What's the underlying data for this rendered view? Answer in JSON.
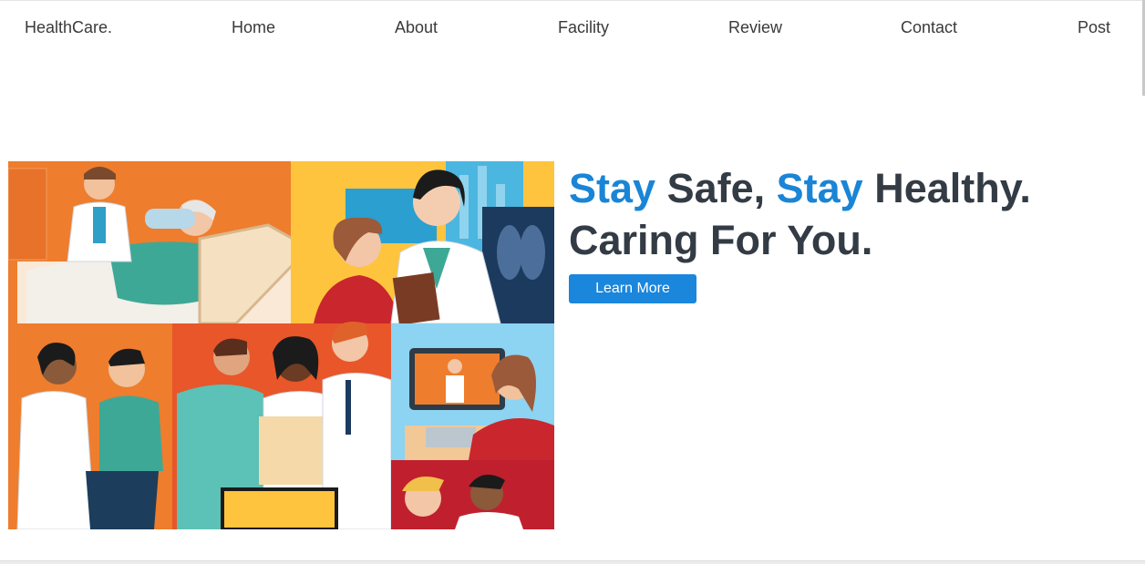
{
  "nav": {
    "brand": "HealthCare.",
    "links": [
      "Home",
      "About",
      "Facility",
      "Review",
      "Contact",
      "Post"
    ]
  },
  "hero": {
    "line1": {
      "w1": "Stay",
      "w2": " Safe, ",
      "w3": "Stay",
      "w4": " Healthy."
    },
    "line2": "Caring For You.",
    "button_label": "Learn More",
    "image_alt": "healthcare-illustration"
  },
  "colors": {
    "accent": "#1a85d6",
    "button": "#1a86dc",
    "text": "#333b45"
  }
}
